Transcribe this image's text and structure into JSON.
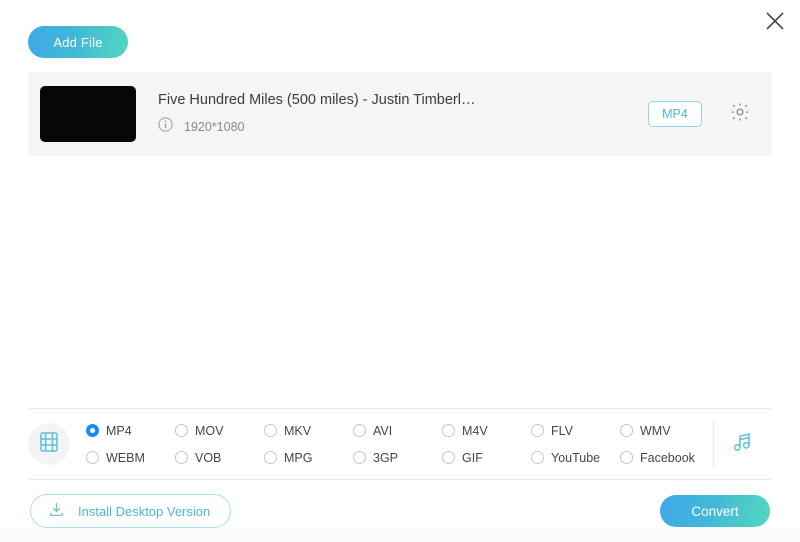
{
  "window": {
    "close_label": "✕",
    "accent_gradient_start": "#3fa9e8",
    "accent_gradient_end": "#54d6c0",
    "teal": "#4db7c8",
    "radio_selected_color": "#1a8bf0"
  },
  "toolbar": {
    "add_file_label": "Add File"
  },
  "files": [
    {
      "title": "Five Hundred Miles (500 miles) - Justin Timberl…",
      "resolution": "1920*1080",
      "output_format_badge": "MP4",
      "info_icon": "info-circle-icon",
      "settings_icon": "gear-icon",
      "thumbnail_color": "#070707"
    }
  ],
  "format_picker": {
    "media_type_icon": "film-strip-icon",
    "audio_icon": "music-note-icon",
    "selected": "MP4",
    "options": [
      "MP4",
      "MOV",
      "MKV",
      "AVI",
      "M4V",
      "FLV",
      "WMV",
      "WEBM",
      "VOB",
      "MPG",
      "3GP",
      "GIF",
      "YouTube",
      "Facebook"
    ]
  },
  "footer": {
    "install_label": "Install Desktop Version",
    "install_icon": "download-icon",
    "convert_label": "Convert"
  }
}
